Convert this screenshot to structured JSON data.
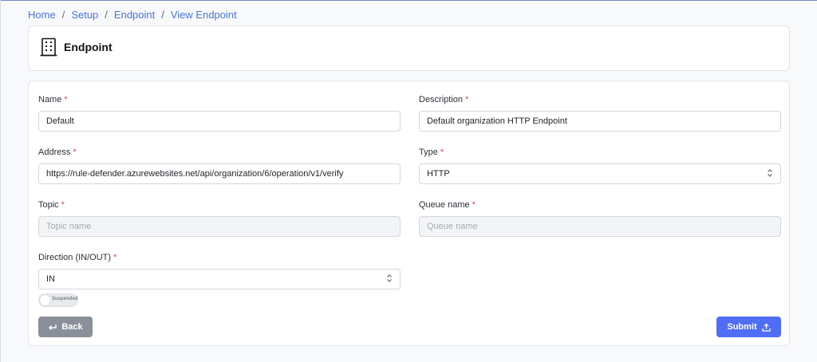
{
  "breadcrumb": {
    "items": [
      "Home",
      "Setup",
      "Endpoint",
      "View Endpoint"
    ],
    "separator": "/"
  },
  "header": {
    "icon": "building-icon",
    "title": "Endpoint"
  },
  "form": {
    "name": {
      "label": "Name",
      "required_mark": "*",
      "value": "Default"
    },
    "description": {
      "label": "Description",
      "required_mark": "*",
      "value": "Default organization HTTP Endpoint"
    },
    "address": {
      "label": "Address",
      "required_mark": "*",
      "value": "https://rule-defender.azurewebsites.net/api/organization/6/operation/v1/verify"
    },
    "type": {
      "label": "Type",
      "required_mark": "*",
      "value": "HTTP"
    },
    "topic": {
      "label": "Topic",
      "required_mark": "*",
      "placeholder": "Topic name"
    },
    "queue_name": {
      "label": "Queue name",
      "required_mark": "*",
      "placeholder": "Queue name"
    },
    "direction": {
      "label": "Direction (IN/OUT)",
      "required_mark": "*",
      "value": "IN"
    },
    "suspended": {
      "label": "Suspended",
      "on": false
    }
  },
  "actions": {
    "back_label": "Back",
    "submit_label": "Submit"
  },
  "colors": {
    "link": "#4a74d8",
    "required": "#e0483e",
    "back_button": "#8a9099",
    "submit_button": "#4f6df5"
  }
}
